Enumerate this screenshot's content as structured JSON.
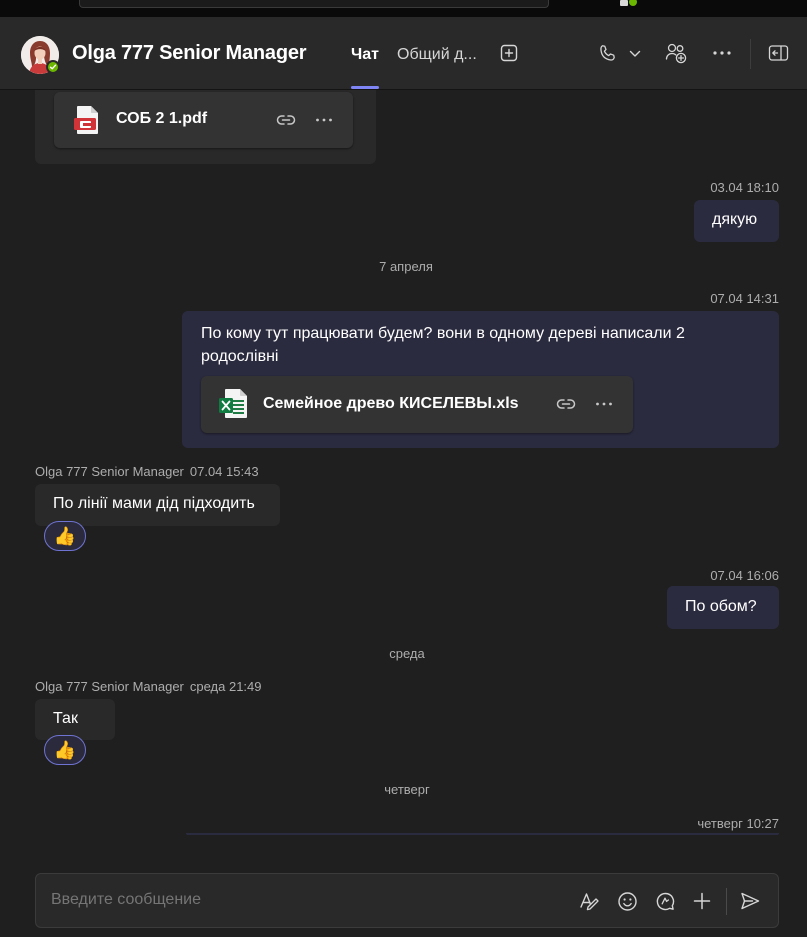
{
  "header": {
    "title": "Olga 777 Senior Manager",
    "tabs": [
      {
        "label": "Чат",
        "active": true
      },
      {
        "label": "Общий д..."
      }
    ],
    "icons": [
      "add-tab-icon",
      "phone-icon",
      "chevron-down-icon",
      "add-people-icon",
      "more-icon",
      "open-side-panel-icon"
    ]
  },
  "messages": {
    "prev_file": {
      "name": "СОБ 2 1.pdf",
      "icon": "pdf-file-icon"
    },
    "m1": {
      "timestamp": "03.04 18:10",
      "text": "дякую"
    },
    "day1": "7 апреля",
    "m2": {
      "timestamp": "07.04 14:31",
      "text_line1": "По кому тут працювати будем? вони в одному дереві написали 2",
      "text_line2": "родослівні",
      "file": {
        "name": "Семейное древо КИСЕЛЕВЫ.xls",
        "icon": "excel-file-icon"
      }
    },
    "m3": {
      "sender": "Olga 777 Senior Manager",
      "time": "07.04 15:43",
      "text": "По лінії мами дід підходить",
      "reaction": "👍"
    },
    "m4": {
      "timestamp": "07.04 16:06",
      "text": "По обом?"
    },
    "day2": "среда",
    "m5": {
      "sender": "Olga 777 Senior Manager",
      "time": "среда 21:49",
      "text": "Так",
      "reaction": "👍"
    },
    "day3": "четверг",
    "m6": {
      "timestamp": "четверг 10:27"
    }
  },
  "composer": {
    "placeholder": "Введите сообщение",
    "icons": [
      "format-icon",
      "emoji-icon",
      "loop-icon",
      "attach-plus-icon",
      "send-icon"
    ]
  },
  "colors": {
    "background": "#1f1f1f",
    "header": "#292929",
    "my_bubble": "#2b2b40",
    "their_bubble": "#292929",
    "accent": "#7f85f5",
    "presence": "#6bb700"
  }
}
